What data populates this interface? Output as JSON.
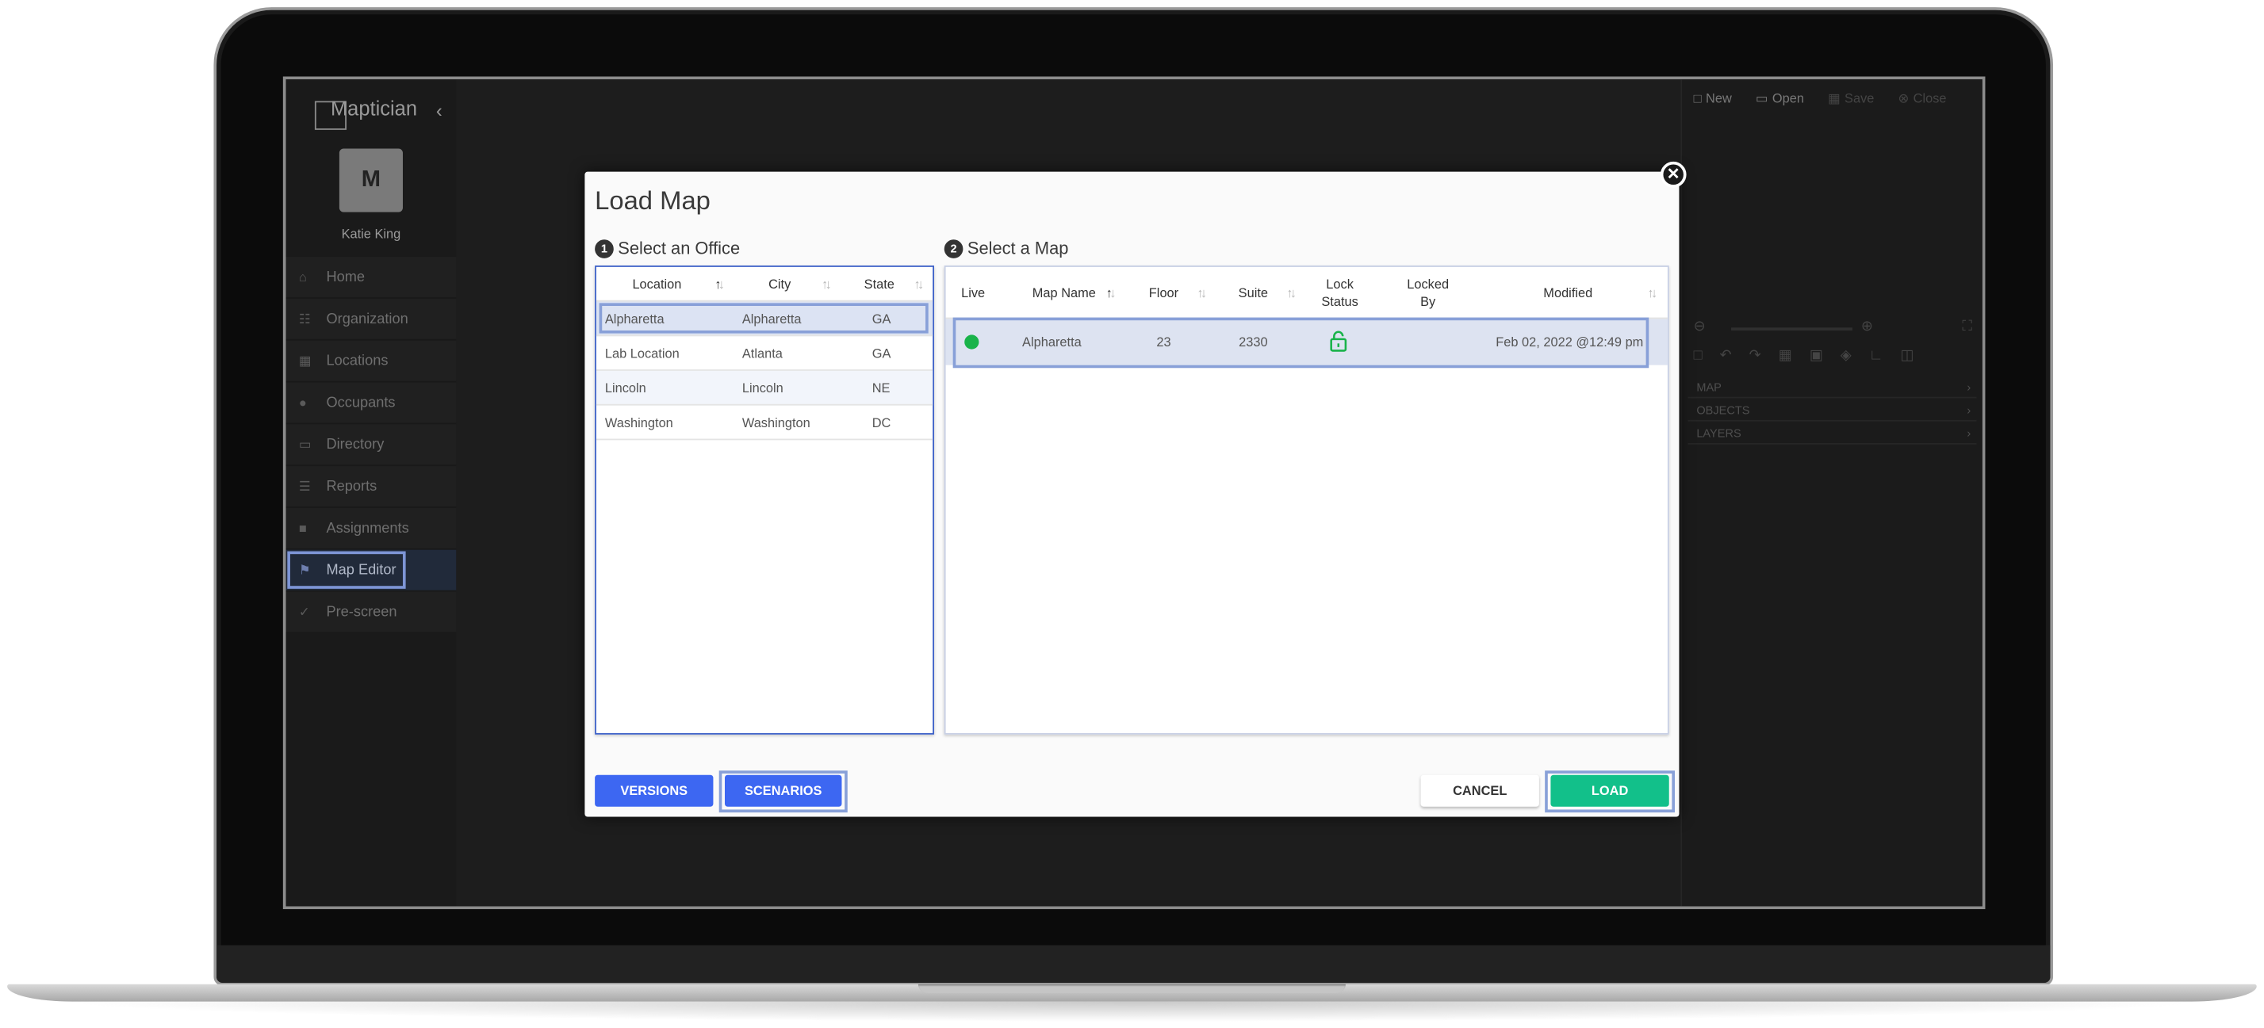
{
  "app": {
    "brand": "Maptician",
    "user_name": "Katie King",
    "avatar_initials": "M",
    "nav": [
      {
        "label": "Home",
        "icon": "home-icon"
      },
      {
        "label": "Organization",
        "icon": "org-chart-icon"
      },
      {
        "label": "Locations",
        "icon": "building-icon"
      },
      {
        "label": "Occupants",
        "icon": "users-icon"
      },
      {
        "label": "Directory",
        "icon": "id-card-icon"
      },
      {
        "label": "Reports",
        "icon": "list-icon"
      },
      {
        "label": "Assignments",
        "icon": "assignment-icon"
      },
      {
        "label": "Map Editor",
        "icon": "map-icon"
      },
      {
        "label": "Pre-screen",
        "icon": "check-icon"
      }
    ],
    "active_nav": "Map Editor",
    "toolbar": {
      "new": "New",
      "open": "Open",
      "save": "Save",
      "close": "Close"
    },
    "panel_sections": [
      "MAP",
      "OBJECTS",
      "LAYERS"
    ]
  },
  "modal": {
    "title": "Load Map",
    "step1": {
      "num": "1",
      "label": "Select an Office"
    },
    "step2": {
      "num": "2",
      "label": "Select a Map"
    },
    "office_columns": [
      "Location",
      "City",
      "State"
    ],
    "offices": [
      {
        "location": "Alpharetta",
        "city": "Alpharetta",
        "state": "GA"
      },
      {
        "location": "Lab Location",
        "city": "Atlanta",
        "state": "GA"
      },
      {
        "location": "Lincoln",
        "city": "Lincoln",
        "state": "NE"
      },
      {
        "location": "Washington",
        "city": "Washington",
        "state": "DC"
      }
    ],
    "map_columns": {
      "live": "Live",
      "map_name": "Map Name",
      "floor": "Floor",
      "suite": "Suite",
      "lock_status": "Lock Status",
      "locked_by": "Locked By",
      "modified": "Modified"
    },
    "maps": [
      {
        "live": true,
        "map_name": "Alpharetta",
        "floor": "23",
        "suite": "2330",
        "lock": "unlocked",
        "locked_by": "",
        "modified": "Feb 02, 2022 @12:49 pm"
      }
    ],
    "buttons": {
      "versions": "VERSIONS",
      "scenarios": "SCENARIOS",
      "cancel": "CANCEL",
      "load": "LOAD"
    },
    "close_icon": "close-icon"
  },
  "colors": {
    "primary": "#3d67f2",
    "success": "#12c08a",
    "live": "#19b34a",
    "highlight": "#88a0d8"
  }
}
